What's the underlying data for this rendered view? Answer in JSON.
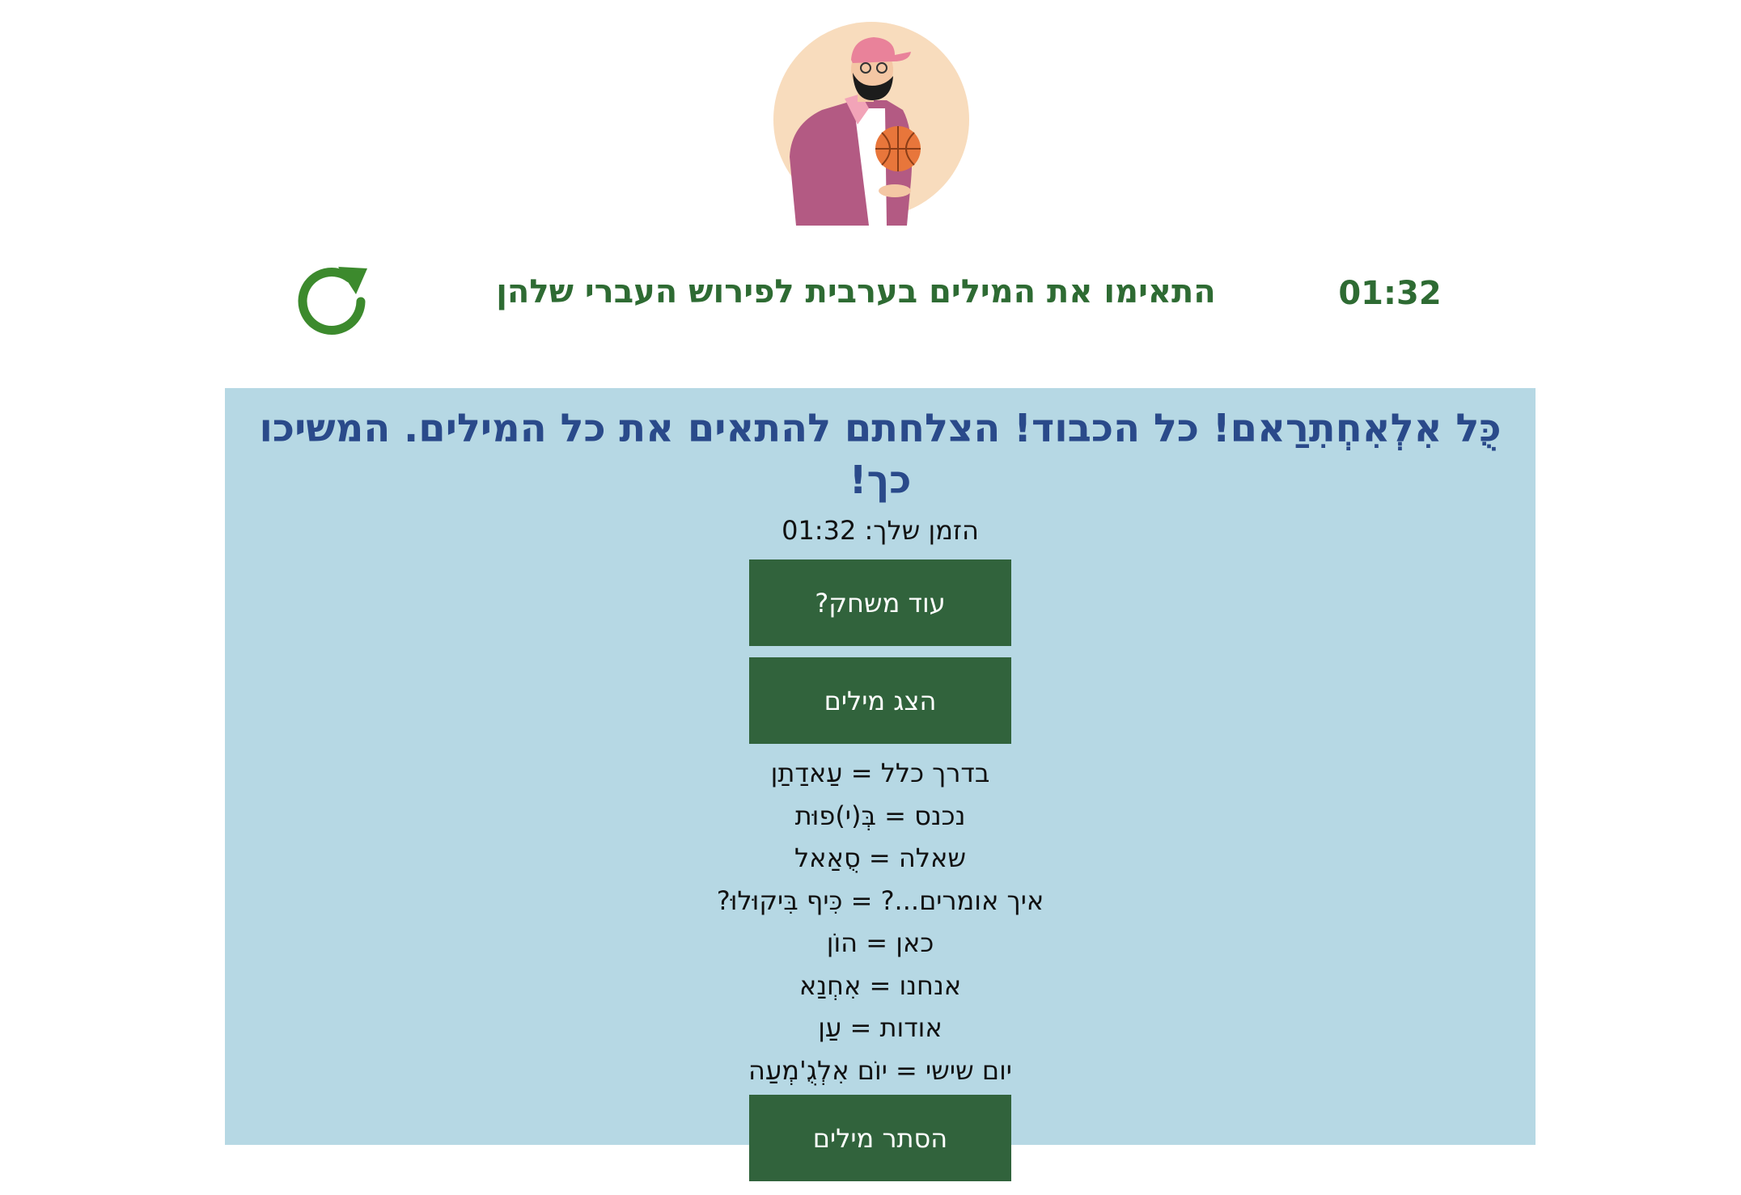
{
  "header": {
    "instructions": "התאימו את המילים בערבית לפירוש העברי שלהן",
    "timer": "01:32",
    "reload_icon": "reload-icon",
    "avatar_icon": "avatar-basketball-man-icon"
  },
  "result_panel": {
    "congrats": "כֻּל אִלְאִחְתִרַאם! כל הכבוד! הצלחתם להתאים את כל המילים. המשיכו כך!",
    "time_text": "הזמן שלך: 01:32",
    "play_again_label": "עוד משחק?",
    "show_words_label": "הצג מילים",
    "hide_words_label": "הסתר מילים",
    "words": [
      "בדרך כלל = עַאדַתַן",
      "נכנס = בְּ(י)פוּת",
      "שאלה = סֻאַאל",
      "איך אומרים...? = כִּיף בִּיקוּלוּ?",
      "כאן = הוֹן",
      "אנחנו = אִחְנַא",
      "אודות = עַן",
      "יום שישי = יוֹם אִלְגֻ'מְעַה"
    ]
  },
  "colors": {
    "accent_green": "#2e6b33",
    "button_green": "#31633c",
    "panel_blue": "#b6d8e4",
    "congrats_blue": "#2a4a8a"
  }
}
